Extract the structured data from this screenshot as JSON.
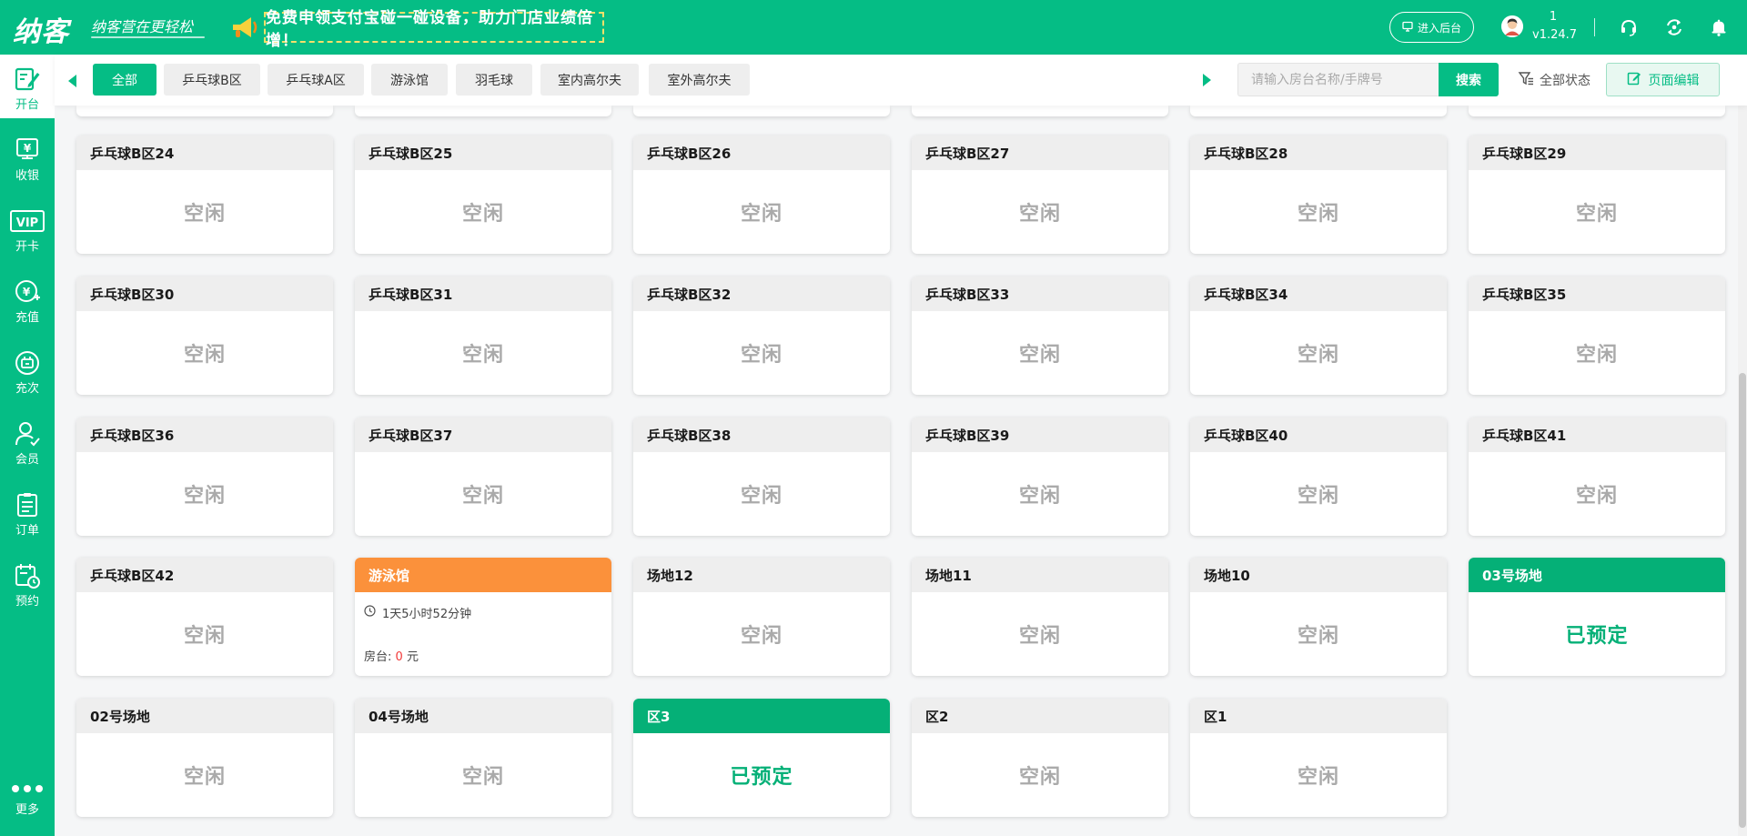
{
  "header": {
    "logo": "纳客",
    "slogan": "纳客营在更轻松",
    "promo": "免费申领支付宝碰一碰设备，助力门店业绩倍增！",
    "backend_button": "进入后台",
    "user_number": "1",
    "version": "v1.24.7"
  },
  "sidebar": {
    "items": [
      {
        "label": "开台"
      },
      {
        "label": "收银"
      },
      {
        "label": "开卡"
      },
      {
        "label": "充值"
      },
      {
        "label": "充次"
      },
      {
        "label": "会员"
      },
      {
        "label": "订单"
      },
      {
        "label": "预约"
      }
    ],
    "more": "更多",
    "vip_text": "VIP"
  },
  "filterbar": {
    "tabs": [
      "全部",
      "乒乓球B区",
      "乒乓球A区",
      "游泳馆",
      "羽毛球",
      "室内高尔夫",
      "室外高尔夫"
    ],
    "search_placeholder": "请输入房台名称/手牌号",
    "search_button": "搜索",
    "status_filter": "全部状态",
    "edit_button": "页面编辑"
  },
  "rooms": [
    {
      "name": "乒乓球B区24",
      "status": "空闲"
    },
    {
      "name": "乒乓球B区25",
      "status": "空闲"
    },
    {
      "name": "乒乓球B区26",
      "status": "空闲"
    },
    {
      "name": "乒乓球B区27",
      "status": "空闲"
    },
    {
      "name": "乒乓球B区28",
      "status": "空闲"
    },
    {
      "name": "乒乓球B区29",
      "status": "空闲"
    },
    {
      "name": "乒乓球B区30",
      "status": "空闲"
    },
    {
      "name": "乒乓球B区31",
      "status": "空闲"
    },
    {
      "name": "乒乓球B区32",
      "status": "空闲"
    },
    {
      "name": "乒乓球B区33",
      "status": "空闲"
    },
    {
      "name": "乒乓球B区34",
      "status": "空闲"
    },
    {
      "name": "乒乓球B区35",
      "status": "空闲"
    },
    {
      "name": "乒乓球B区36",
      "status": "空闲"
    },
    {
      "name": "乒乓球B区37",
      "status": "空闲"
    },
    {
      "name": "乒乓球B区38",
      "status": "空闲"
    },
    {
      "name": "乒乓球B区39",
      "status": "空闲"
    },
    {
      "name": "乒乓球B区40",
      "status": "空闲"
    },
    {
      "name": "乒乓球B区41",
      "status": "空闲"
    },
    {
      "name": "乒乓球B区42",
      "status": "空闲"
    },
    {
      "name": "游泳馆",
      "status": "in-use",
      "duration": "1天5小时52分钟",
      "fee_label": "房台:",
      "fee_value": "0",
      "fee_unit": "元"
    },
    {
      "name": "场地12",
      "status": "空闲"
    },
    {
      "name": "场地11",
      "status": "空闲"
    },
    {
      "name": "场地10",
      "status": "空闲"
    },
    {
      "name": "03号场地",
      "status": "已预定"
    },
    {
      "name": "02号场地",
      "status": "空闲"
    },
    {
      "name": "04号场地",
      "status": "空闲"
    },
    {
      "name": "区3",
      "status": "已预定"
    },
    {
      "name": "区2",
      "status": "空闲"
    },
    {
      "name": "区1",
      "status": "空闲"
    }
  ],
  "colors": {
    "brand": "#05bd85",
    "booked": "#05b077",
    "in_use": "#fb913b",
    "fee_value": "#f23a3a"
  }
}
